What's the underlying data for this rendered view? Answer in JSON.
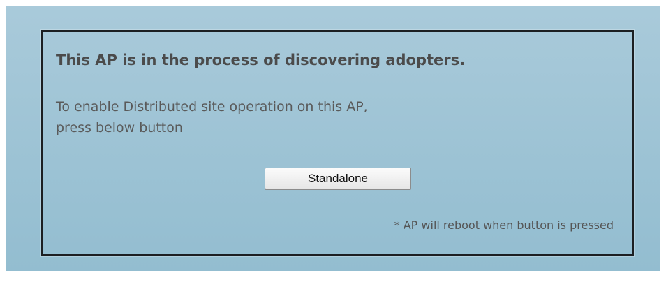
{
  "dialog": {
    "title": "This AP is in the process of discovering adopters.",
    "instruction_line_1": "To enable Distributed site operation on this AP,",
    "instruction_line_2": "press below button",
    "button_label": "Standalone",
    "note": "* AP will reboot when button is pressed"
  },
  "colors": {
    "background_top": "#a9cada",
    "background_bottom": "#93bdd0",
    "border": "#1c1f22",
    "title_text": "#4b4b4b",
    "body_text": "#5a5a5a"
  }
}
